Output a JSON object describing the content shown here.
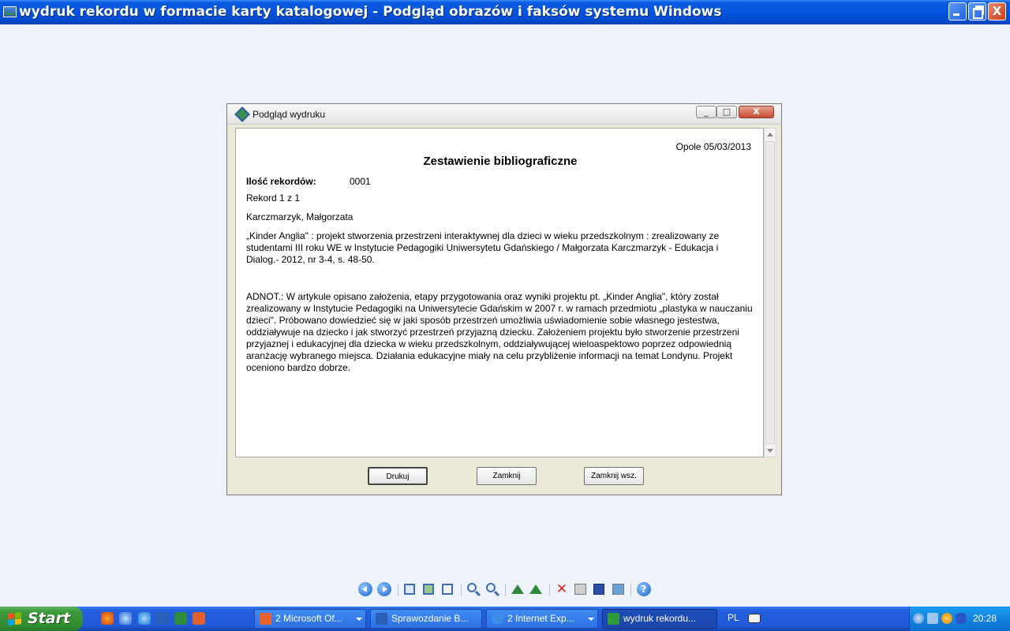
{
  "window": {
    "title": "wydruk rekordu w formacie karty katalogowej - Podgląd obrazów i faksów systemu Windows"
  },
  "dialog": {
    "title": "Podgląd wydruku",
    "close_glyph": "X",
    "document": {
      "date": "Opole 05/03/2013",
      "heading": "Zestawienie bibliograficzne",
      "count_label": "Ilość rekordów:",
      "count_value": "0001",
      "record_number": "Rekord 1 z 1",
      "author": "Karczmarzyk, Małgorzata",
      "description": "„Kinder Anglia\" : projekt stworzenia przestrzeni interaktywnej dla dzieci w wieku przedszkolnym : zrealizowany ze studentami III roku WE w Instytucie Pedagogiki Uniwersytetu Gdańskiego / Małgorzata Karczmarzyk - Edukacja i Dialog.- 2012, nr 3-4, s. 48-50.",
      "annotation": "ADNOT.: W artykule opisano założenia, etapy przygotowania oraz wyniki projektu pt. „Kinder Anglia\", który został zrealizowany w Instytucie Pedagogiki na Uniwersytecie Gdańskim w 2007 r. w ramach przedmiotu „plastyka w nauczaniu dzieci\". Próbowano dowiedzieć się w jaki sposób przestrzeń umożliwia uświadomienie sobie własnego jestestwa, oddziaływuje na dziecko i jak stworzyć przestrzeń przyjazną dziecku. Założeniem projektu było stworzenie przestrzeni przyjaznej i edukacyjnej dla dziecka w wieku przedszkolnym, oddziaływującej wieloaspektowo poprzez odpowiednią aranżację wybranego miejsca. Działania edukacyjne miały na celu przybliżenie informacji na temat Londynu. Projekt oceniono bardzo dobrze."
    },
    "buttons": {
      "print": "Drukuj",
      "close": "Zamknij",
      "close_all": "Zamknij wsz."
    }
  },
  "toolbar_icons": [
    "previous-image-icon",
    "next-image-icon",
    "best-fit-icon",
    "actual-size-icon",
    "slideshow-icon",
    "zoom-in-icon",
    "zoom-out-icon",
    "rotate-clockwise-icon",
    "rotate-counterclockwise-icon",
    "delete-icon",
    "print-icon",
    "save-icon",
    "edit-icon",
    "help-icon"
  ],
  "help_glyph": "?",
  "delete_glyph": "✕",
  "taskbar": {
    "start_label": "Start",
    "tasks": [
      {
        "label": "2 Microsoft Of...",
        "icon_color": "#e8642c"
      },
      {
        "label": "Sprawozdanie B...",
        "icon_color": "#2a5fb8"
      },
      {
        "label": "2 Internet Exp...",
        "icon_color": "#3a8ee8"
      },
      {
        "label": "wydruk rekordu...",
        "icon_color": "#2e9a3a"
      }
    ],
    "language": "PL",
    "clock": "20:28"
  },
  "colors": {
    "titlebar_blue": "#0554df",
    "taskbar_blue": "#245edc",
    "start_green": "#3c9a3c",
    "desktop_bg": "#eef3fa"
  }
}
